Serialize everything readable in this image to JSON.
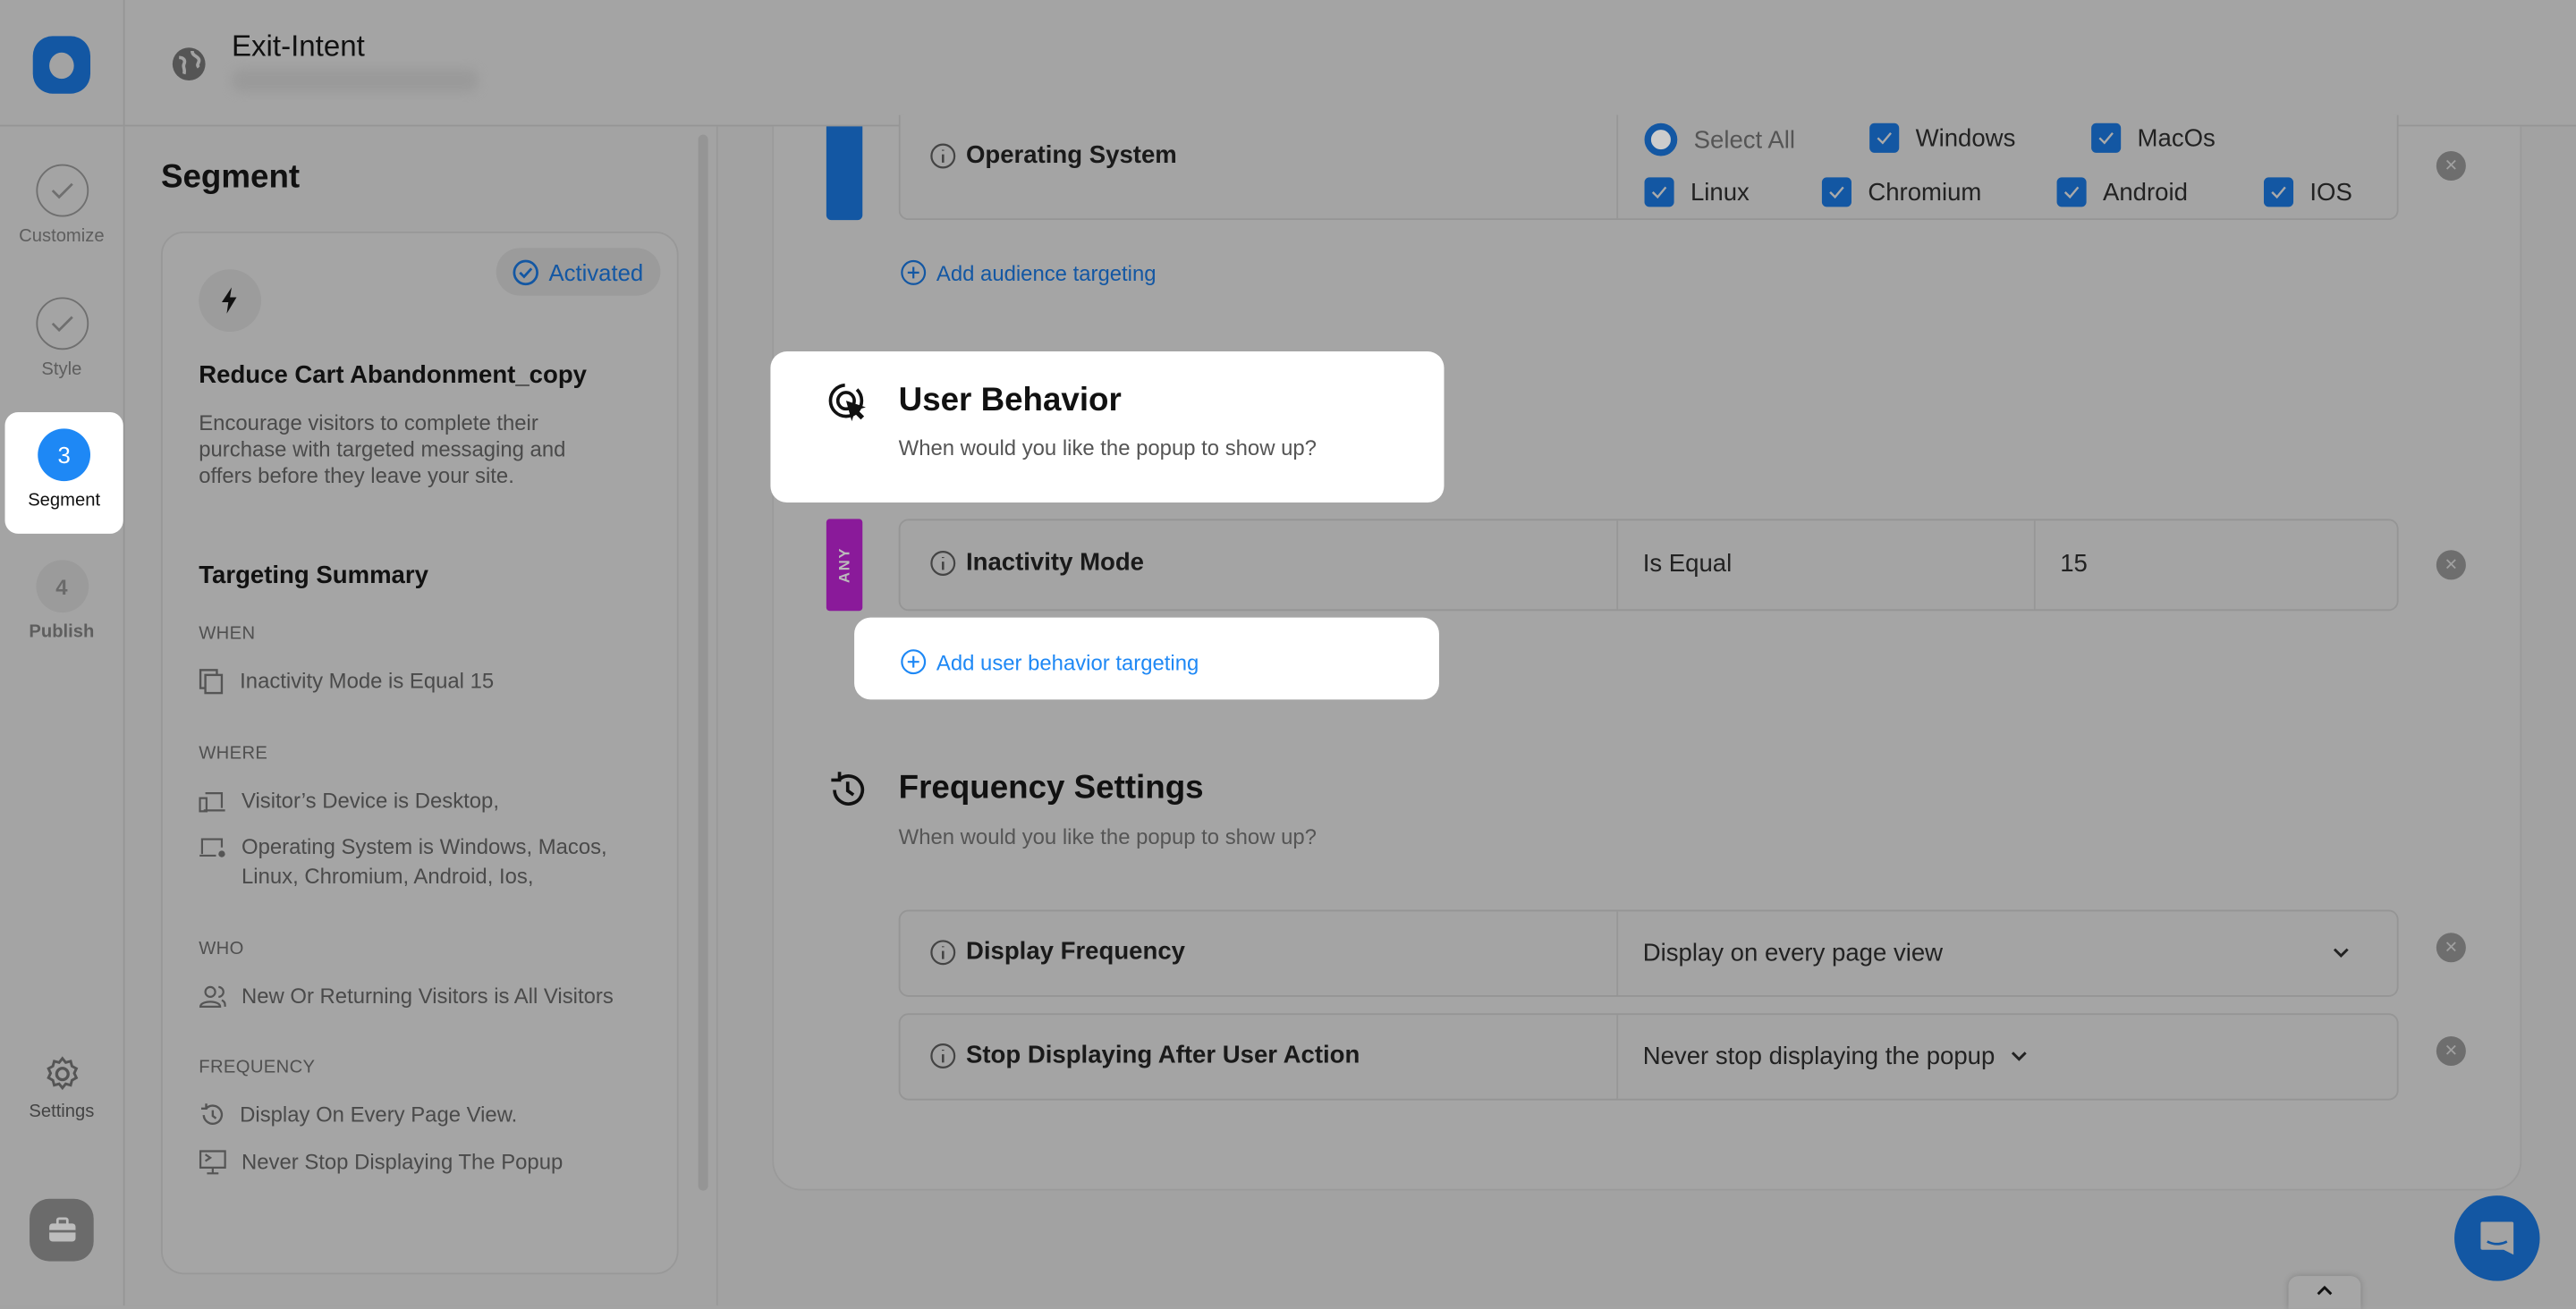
{
  "header": {
    "title": "Exit-Intent",
    "subtitle_blurred": true
  },
  "colors": {
    "accent": "#1e88f5",
    "accent_dimmed": "#1357a3",
    "any_badge": "#8a1a9a",
    "overlay": "#a3a3a3"
  },
  "rail": {
    "steps": [
      {
        "label": "Customize",
        "state": "done"
      },
      {
        "label": "Style",
        "state": "done"
      },
      {
        "number": "3",
        "label": "Segment",
        "state": "active"
      },
      {
        "number": "4",
        "label": "Publish",
        "state": "pending"
      }
    ],
    "settings_label": "Settings"
  },
  "panel": {
    "title": "Segment",
    "card": {
      "badge": "Activated",
      "name": "Reduce Cart Abandonment_copy",
      "description": "Encourage visitors to complete their purchase with targeted messaging and offers before they leave your site."
    },
    "summary": {
      "title": "Targeting Summary",
      "sections": [
        {
          "label": "WHEN",
          "items": [
            "Inactivity Mode is Equal 15"
          ]
        },
        {
          "label": "WHERE",
          "items": [
            "Visitor’s Device is Desktop,",
            "Operating System is Windows, Macos, Linux, Chromium, Android, Ios,"
          ]
        },
        {
          "label": "WHO",
          "items": [
            "New Or Returning Visitors is All Visitors"
          ]
        },
        {
          "label": "FREQUENCY",
          "items": [
            "Display On Every Page View.",
            "Never Stop Displaying The Popup"
          ]
        }
      ]
    }
  },
  "main": {
    "os_row": {
      "label": "Operating System",
      "options": [
        {
          "label": "Select All",
          "type": "radio"
        },
        {
          "label": "Windows",
          "checked": true
        },
        {
          "label": "MacOs",
          "checked": true
        },
        {
          "label": "Linux",
          "checked": true
        },
        {
          "label": "Chromium",
          "checked": true
        },
        {
          "label": "Android",
          "checked": true
        },
        {
          "label": "IOS",
          "checked": true
        }
      ]
    },
    "add_audience": "Add audience targeting",
    "user_behavior": {
      "title": "User Behavior",
      "subtitle": "When would you like the popup to show up?",
      "badge": "ANY",
      "row": {
        "label": "Inactivity Mode",
        "operator": "Is Equal",
        "value": "15"
      },
      "add": "Add user behavior targeting"
    },
    "frequency": {
      "title": "Frequency Settings",
      "subtitle": "When would you like the popup to show up?",
      "rows": [
        {
          "label": "Display Frequency",
          "value": "Display on every page view"
        },
        {
          "label": "Stop Displaying After User Action",
          "value": "Never stop displaying the popup"
        }
      ]
    }
  }
}
